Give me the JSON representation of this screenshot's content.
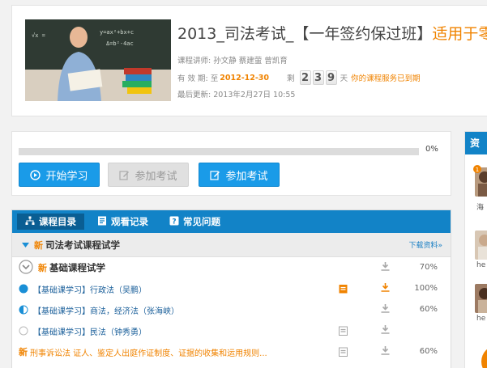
{
  "course": {
    "title_main": "2013_司法考试_【一年签约保过班】",
    "title_highlight": "适用于零",
    "lecturers": "课程讲师:  孙文静  蔡建萤  曾凯育",
    "valid_label": "有  效  期:  至",
    "expire_date": "2012-12-30",
    "remain_label": "剩",
    "remain_days": [
      "2",
      "3",
      "9"
    ],
    "days_unit": "天",
    "service_note": "你的课程服务已到期",
    "updated": "最后更新:  2013年2月27日  10:55"
  },
  "progress": {
    "value": 0,
    "label": "0%"
  },
  "buttons": {
    "start": "开始学习",
    "exam_disabled": "参加考试",
    "exam": "参加考试"
  },
  "tabs": [
    {
      "label": "课程目录",
      "icon": "sitemap-icon"
    },
    {
      "label": "观看记录",
      "icon": "list-icon"
    },
    {
      "label": "常见问题",
      "icon": "question-icon"
    }
  ],
  "section": {
    "badge": "新",
    "title": "司法考试课程试学",
    "download": "下载资料»"
  },
  "rows": [
    {
      "badge": "新",
      "label": "基础课程试学",
      "pct": "70%"
    },
    {
      "label": "【基础课学习】行政法（吴鹏）",
      "pct": "100%"
    },
    {
      "label": "【基础课学习】商法，经济法（张海峡）",
      "pct": "60%"
    },
    {
      "label": "【基础课学习】民法（钟秀勇）",
      "pct": ""
    },
    {
      "badge": "新",
      "label": "刑事诉讼法 证人、鉴定人出庭作证制度、证据的收集和运用规则...",
      "pct": "60%"
    }
  ],
  "sidebar": {
    "head": "资",
    "names": [
      "海",
      "he",
      "he"
    ]
  },
  "colors": {
    "accent": "#1a9be8",
    "brand_blue": "#1283c7",
    "highlight_orange": "#f08300"
  }
}
